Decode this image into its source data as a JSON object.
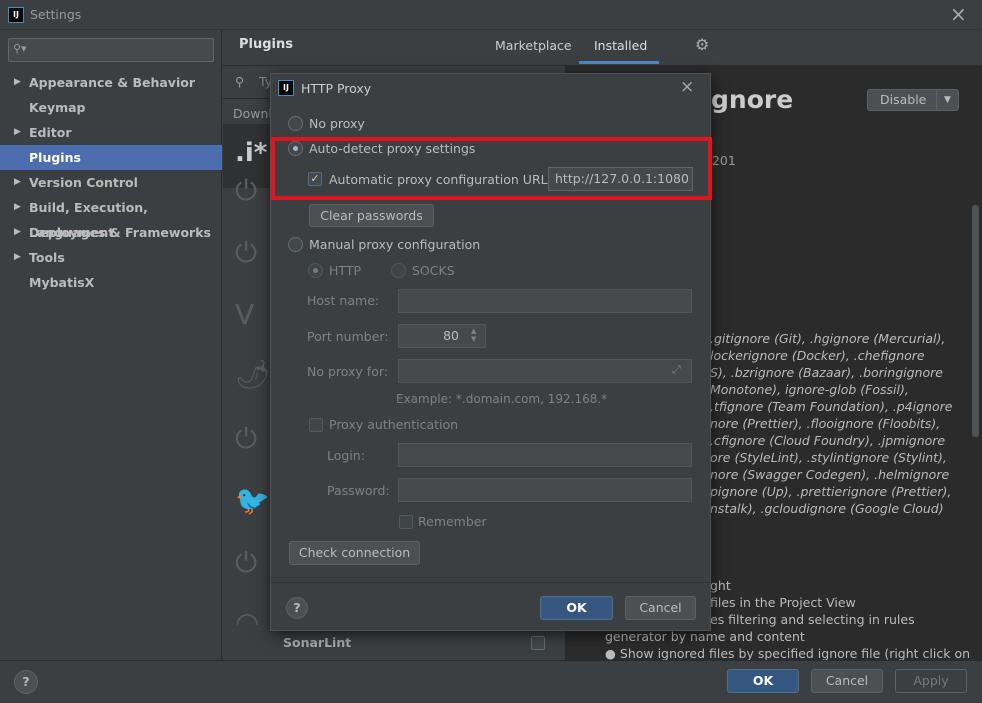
{
  "window": {
    "title": "Settings",
    "close": "×"
  },
  "sidebar": {
    "search_placeholder": "",
    "items": [
      {
        "label": "Appearance & Behavior",
        "expandable": true
      },
      {
        "label": "Keymap",
        "expandable": false
      },
      {
        "label": "Editor",
        "expandable": true
      },
      {
        "label": "Plugins",
        "expandable": false,
        "selected": true
      },
      {
        "label": "Version Control",
        "expandable": true
      },
      {
        "label": "Build, Execution, Deployment",
        "expandable": true
      },
      {
        "label": "Languages & Frameworks",
        "expandable": true
      },
      {
        "label": "Tools",
        "expandable": true
      },
      {
        "label": "MybatisX",
        "expandable": false
      }
    ]
  },
  "plugins": {
    "title": "Plugins",
    "tabs": [
      "Marketplace",
      "Installed"
    ],
    "active_tab": "Installed",
    "search_partial": "Ty",
    "downloaded_partial": "Downl",
    "list_last": "SonarLint"
  },
  "detail": {
    "title_partial": "gnore",
    "version_partial": ".201",
    "disable_label": "Disable",
    "italic_lines": [
      ".gitignore (Git), .hgignore (Mercurial),",
      "lockerignore (Docker), .chefignore",
      "S), .bzrignore (Bazaar), .boringignore",
      "Monotone), ignore-glob (Fossil),",
      ".tfignore (Team Foundation), .p4ignore",
      "nore (Prettier), .flooignore (Floobits),",
      ".cfignore (Cloud Foundry), .jpmignore",
      "ore (StyleLint), .stylintignore (Stylint),",
      "nore (Swagger Codegen), .helmignore",
      "pignore (Up), .prettierignore (Prettier),",
      "nstalk), .gcloudignore (Google Cloud)"
    ],
    "feature_lines": [
      "ght",
      "files in the Project View",
      "es filtering and selecting in rules",
      "generator by name and content",
      "Show ignored files by specified ignore file (right click on"
    ]
  },
  "dialog": {
    "title": "HTTP Proxy",
    "no_proxy": "No proxy",
    "auto_detect": "Auto-detect proxy settings",
    "auto_url_label": "Automatic proxy configuration URL:",
    "auto_url_value": "http://127.0.0.1:1080",
    "clear_passwords": "Clear passwords",
    "manual": "Manual proxy configuration",
    "http": "HTTP",
    "socks": "SOCKS",
    "host_label": "Host name:",
    "host_value": "",
    "port_label": "Port number:",
    "port_value": "80",
    "no_proxy_for_label": "No proxy for:",
    "no_proxy_for_value": "",
    "example": "Example: *.domain.com, 192.168.*",
    "proxy_auth": "Proxy authentication",
    "login_label": "Login:",
    "password_label": "Password:",
    "remember": "Remember",
    "check_connection": "Check connection",
    "ok": "OK",
    "cancel": "Cancel",
    "help": "?",
    "highlight_color": "#e0141e"
  },
  "footer": {
    "help": "?",
    "ok": "OK",
    "cancel": "Cancel",
    "apply": "Apply"
  }
}
